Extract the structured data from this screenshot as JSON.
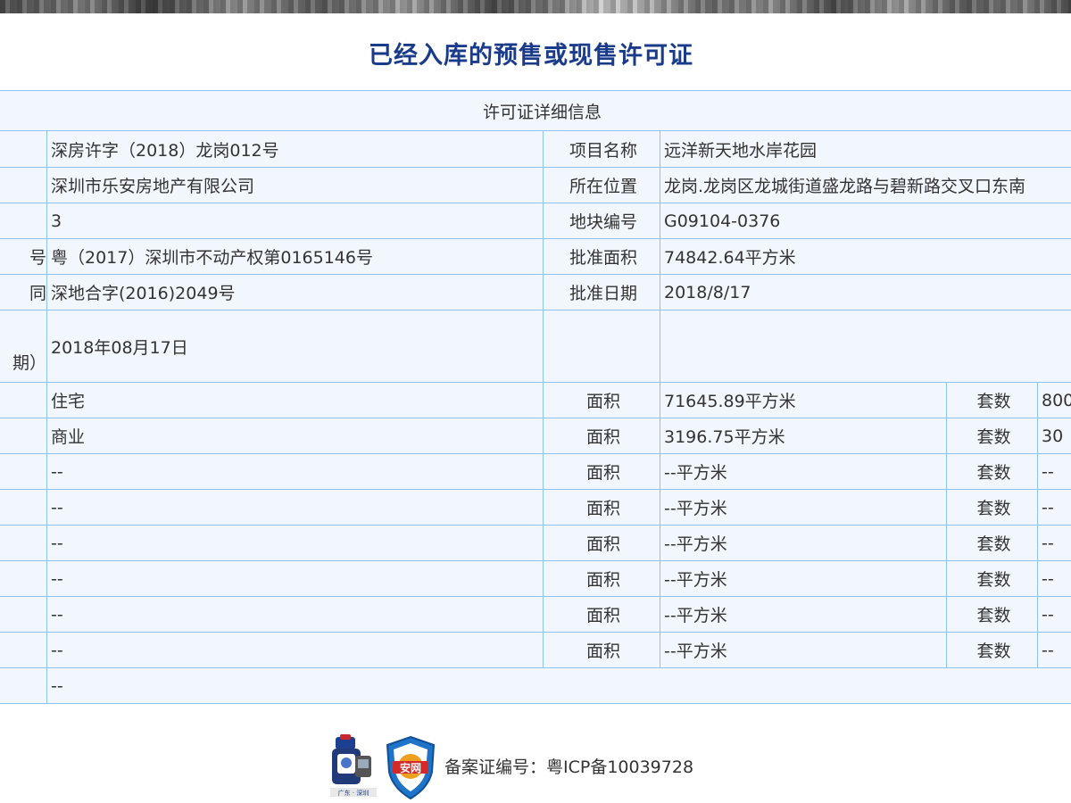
{
  "page": {
    "title": "已经入库的预售或现售许可证"
  },
  "table": {
    "heading": "许可证详细信息",
    "rows_top": [
      {
        "left_label": "",
        "left_value": "深房许字（2018）龙岗012号",
        "right_label": "项目名称",
        "right_value": "远洋新天地水岸花园"
      },
      {
        "left_label": "",
        "left_value": "深圳市乐安房地产有限公司",
        "right_label": "所在位置",
        "right_value": "龙岗.龙岗区龙城街道盛龙路与碧新路交叉口东南"
      },
      {
        "left_label": "",
        "left_value": "3",
        "right_label": "地块编号",
        "right_value": "G09104-0376"
      },
      {
        "left_label": "号",
        "left_value": "粤（2017）深圳市不动产权第0165146号",
        "right_label": "批准面积",
        "right_value": "74842.64平方米"
      },
      {
        "left_label": "同",
        "left_value": "深地合字(2016)2049号",
        "right_label": "批准日期",
        "right_value": "2018/8/17"
      }
    ],
    "date_row": {
      "left_label_line1": "",
      "left_label_line2": "期）",
      "value": "2018年08月17日"
    },
    "usage_rows": [
      {
        "label": "",
        "use": "住宅",
        "area_label": "面积",
        "area": "71645.89平方米",
        "units_label": "套数",
        "units": "800"
      },
      {
        "label": "",
        "use": "商业",
        "area_label": "面积",
        "area": "3196.75平方米",
        "units_label": "套数",
        "units": "30"
      },
      {
        "label": "",
        "use": "--",
        "area_label": "面积",
        "area": "--平方米",
        "units_label": "套数",
        "units": "--"
      },
      {
        "label": "",
        "use": "--",
        "area_label": "面积",
        "area": "--平方米",
        "units_label": "套数",
        "units": "--"
      },
      {
        "label": "",
        "use": "--",
        "area_label": "面积",
        "area": "--平方米",
        "units_label": "套数",
        "units": "--"
      },
      {
        "label": "",
        "use": "--",
        "area_label": "面积",
        "area": "--平方米",
        "units_label": "套数",
        "units": "--"
      },
      {
        "label": "",
        "use": "--",
        "area_label": "面积",
        "area": "--平方米",
        "units_label": "套数",
        "units": "--"
      },
      {
        "label": "",
        "use": "--",
        "area_label": "面积",
        "area": "--平方米",
        "units_label": "套数",
        "units": "--"
      }
    ],
    "last_row": {
      "label": "",
      "value": "--"
    }
  },
  "footer": {
    "icp_text": "备案证编号：粤ICP备10039728",
    "police_badge_text": "安网",
    "police_badge_sub": "广东 · 深圳"
  },
  "colors": {
    "title": "#1a3a8a",
    "grid": "#8cc4ef",
    "cell_bg": "#f2f7fd"
  }
}
